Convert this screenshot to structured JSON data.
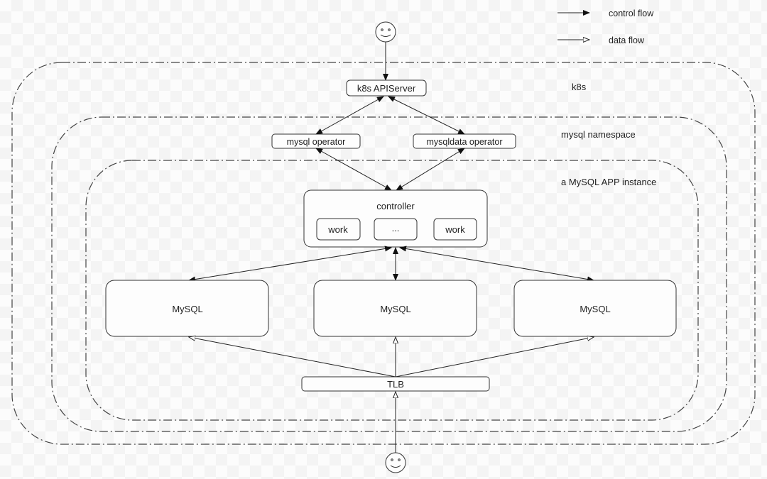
{
  "legend": {
    "control_flow_label": "control flow",
    "data_flow_label": "data flow"
  },
  "boundaries": {
    "k8s": "k8s",
    "namespace": "mysql namespace",
    "app_instance": "a MySQL APP instance"
  },
  "nodes": {
    "apiserver": "k8s APIServer",
    "mysql_operator": "mysql operator",
    "mysqldata_operator": "mysqldata operator",
    "controller": "controller",
    "workers": [
      "work",
      "...",
      "work"
    ],
    "mysql": [
      "MySQL",
      "MySQL",
      "MySQL"
    ],
    "tlb": "TLB"
  },
  "actors": {
    "top_user": "user-icon",
    "bottom_user": "user-icon"
  },
  "colors": {
    "line": "#222222",
    "boundary": "#444444"
  }
}
